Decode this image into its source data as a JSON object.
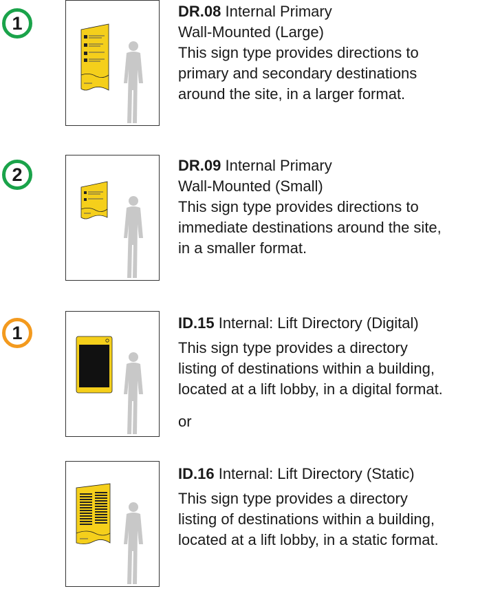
{
  "entries": [
    {
      "badge": "1",
      "badge_color": "#1aa34a",
      "code": "DR.08",
      "title_line1": " Internal Primary",
      "title_line2": "Wall-Mounted (Large)",
      "desc_lines": [
        "This sign type provides directions to",
        "primary and secondary destinations",
        "around the site, in a larger format."
      ],
      "sign_icon": "large-wall-sign-illustration"
    },
    {
      "badge": "2",
      "badge_color": "#1aa34a",
      "code": "DR.09",
      "title_line1": " Internal Primary",
      "title_line2": "Wall-Mounted (Small)",
      "desc_lines": [
        "This sign type provides directions to",
        "immediate destinations around the site,",
        "in a smaller format."
      ],
      "sign_icon": "small-wall-sign-illustration"
    },
    {
      "badge": "1",
      "badge_color": "#f39a1e",
      "code": "ID.15",
      "title_line1": " Internal: Lift Directory (Digital)",
      "desc_lines": [
        "This sign type provides a directory",
        "listing of destinations within a building,",
        "located at a lift lobby, in a digital format."
      ],
      "sign_icon": "digital-directory-illustration"
    },
    {
      "code": "ID.16",
      "title_line1": " Internal: Lift Directory (Static)",
      "desc_lines": [
        "This sign type provides a directory",
        "listing of destinations within a building,",
        "located at a lift lobby, in a static format."
      ],
      "sign_icon": "static-directory-illustration"
    }
  ],
  "or_text": "or"
}
